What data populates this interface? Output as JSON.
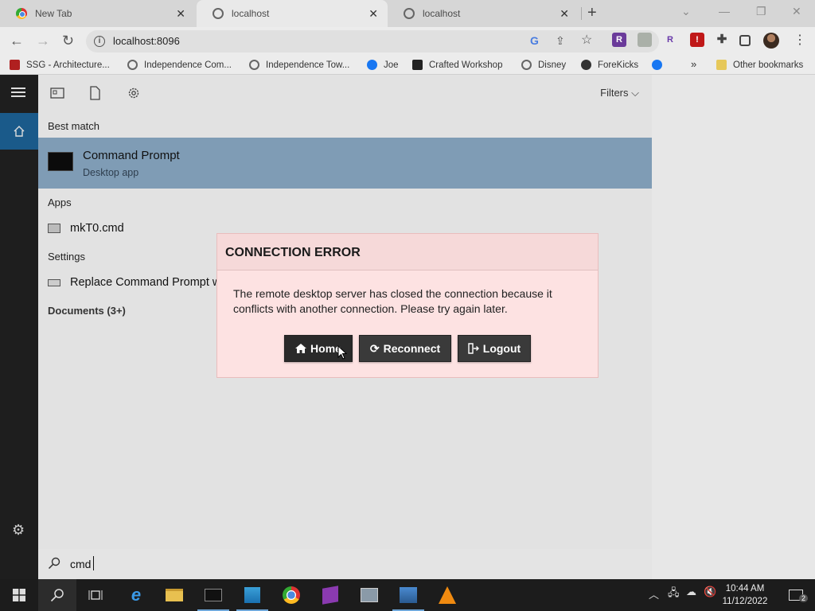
{
  "browser": {
    "tabs": [
      {
        "label": "New Tab",
        "icon": "chrome-icon"
      },
      {
        "label": "localhost",
        "icon": "globe-icon"
      },
      {
        "label": "localhost",
        "icon": "globe-icon"
      }
    ],
    "url": "localhost:8096",
    "bookmarks": [
      {
        "label": "SSG - Architecture...",
        "icon": "pdf-icon"
      },
      {
        "label": "Independence Com...",
        "icon": "globe-icon"
      },
      {
        "label": "Independence Tow...",
        "icon": "globe-icon"
      },
      {
        "label": "Joe",
        "icon": "facebook-icon"
      },
      {
        "label": "Crafted Workshop",
        "icon": "crafted-icon"
      },
      {
        "label": "Disney",
        "icon": "globe-icon"
      },
      {
        "label": "ForeKicks",
        "icon": "forekicks-icon"
      }
    ],
    "more_bookmarks": "»",
    "other_bookmarks": "Other bookmarks"
  },
  "start_search": {
    "filters_label": "Filters",
    "best_match_heading": "Best match",
    "best_match": {
      "title": "Command Prompt",
      "subtitle": "Desktop app"
    },
    "apps_heading": "Apps",
    "apps": [
      {
        "label": "mkT0.cmd"
      }
    ],
    "settings_heading": "Settings",
    "settings": [
      {
        "label": "Replace Command Prompt w"
      }
    ],
    "documents_heading": "Documents (3+)",
    "query": "cmd"
  },
  "dialog": {
    "title": "CONNECTION ERROR",
    "message": "The remote desktop server has closed the connection because it conflicts with another connection. Please try again later.",
    "buttons": {
      "home": "Home",
      "reconnect": "Reconnect",
      "logout": "Logout"
    }
  },
  "taskbar": {
    "time": "10:44 AM",
    "date": "11/12/2022",
    "notification_count": "2"
  },
  "colors": {
    "best_match_bg": "#7f9cb5",
    "dialog_bg": "#fde2e2",
    "dialog_button": "#3a3a3a",
    "start_active": "#1a5a8a"
  }
}
